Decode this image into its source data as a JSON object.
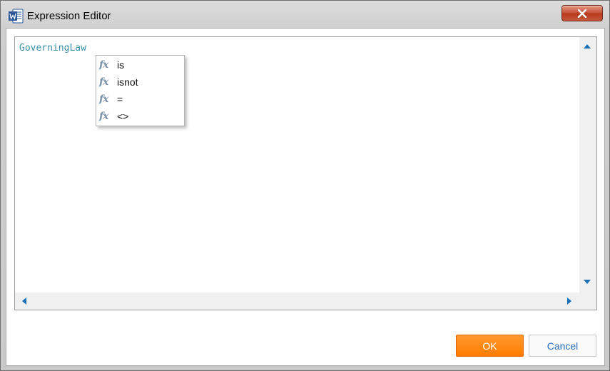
{
  "window": {
    "title": "Expression Editor",
    "app_icon": "word-icon",
    "close_icon": "close-icon"
  },
  "editor": {
    "text": "GoverningLaw",
    "text_color": "#3a8fa8"
  },
  "autocomplete": {
    "icon": "function-icon",
    "icon_glyph": "fx",
    "items": [
      {
        "label": "is"
      },
      {
        "label": "isnot"
      },
      {
        "label": "="
      },
      {
        "label": "<>"
      }
    ]
  },
  "scrollbars": {
    "arrow_color": "#1a6fb5"
  },
  "buttons": {
    "ok_label": "OK",
    "ok_color": "#ff7c00",
    "cancel_label": "Cancel",
    "cancel_text_color": "#2a6ebb"
  }
}
